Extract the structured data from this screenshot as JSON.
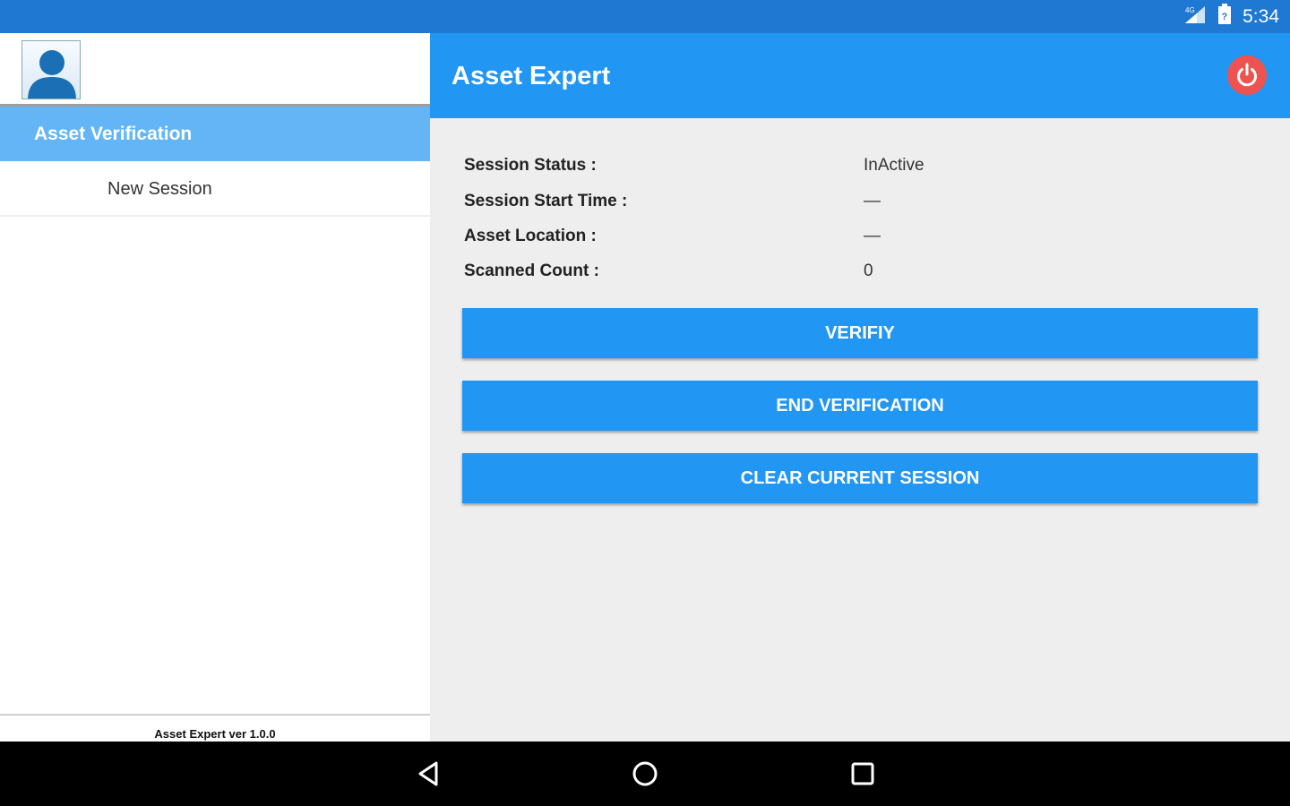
{
  "status_bar": {
    "time": "5:34",
    "icons": [
      "signal-icon",
      "battery-icon"
    ]
  },
  "drawer": {
    "section_title": "Asset Verification",
    "items": [
      {
        "label": "New Session"
      }
    ],
    "footer": "Asset Expert ver 1.0.0"
  },
  "app_bar": {
    "title": "Asset Expert",
    "action_icon": "power-icon"
  },
  "session": [
    {
      "label": "Session Status :",
      "value": "InActive"
    },
    {
      "label": "Session Start Time  :",
      "value": "—"
    },
    {
      "label": "Asset Location  :",
      "value": "—"
    },
    {
      "label": "Scanned Count  :",
      "value": "0"
    }
  ],
  "buttons": {
    "verify": "VERIFIY",
    "end": "END VERIFICATION",
    "clear": "CLEAR CURRENT SESSION"
  },
  "nav_bar": {
    "icons": [
      "back-icon",
      "home-icon",
      "recents-icon"
    ]
  },
  "colors": {
    "primary": "#2196f3",
    "status_bar": "#1f78d1",
    "section_header": "#64b5f6",
    "power": "#ef5350"
  }
}
